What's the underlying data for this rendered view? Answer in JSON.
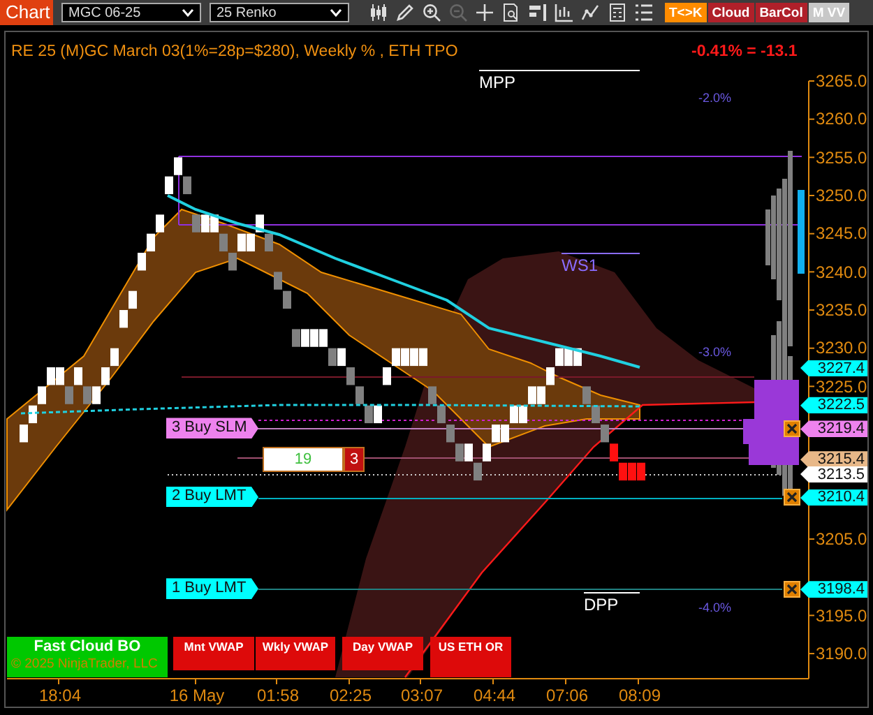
{
  "toolbar": {
    "title": "Chart",
    "instrument": "MGC 06-25",
    "bar_type": "25 Renko",
    "buttons": [
      {
        "label": "T<>K",
        "color": "#ff8c00"
      },
      {
        "label": "Cloud",
        "color": "#b0202a"
      },
      {
        "label": "BarCol",
        "color": "#b0202a"
      },
      {
        "label": "M VV",
        "color": "#c8c8c8"
      }
    ]
  },
  "chart": {
    "header": "RE 25 (M)GC March 03(1%=28p=$280), Weekly % , ETH TPO",
    "change": "-0.41% = -13.1",
    "levels": [
      {
        "label": "MPP",
        "kind": "pivot"
      },
      {
        "label": "WS1",
        "kind": "support"
      },
      {
        "label": "DPP",
        "kind": "pivot"
      }
    ],
    "percent_labels": [
      "-2.0%",
      "-3.0%",
      "-4.0%"
    ],
    "price_axis": [
      "3265.0",
      "3260.0",
      "3255.0",
      "3250.0",
      "3245.0",
      "3240.0",
      "3235.0",
      "3230.0",
      "3225.0",
      "3205.0",
      "3195.0",
      "3190.0"
    ],
    "price_markers": [
      {
        "label": "3227.4",
        "color": "#00ffff"
      },
      {
        "label": "3222.5",
        "color": "#00ffff"
      },
      {
        "label": "3219.4",
        "color": "#ee82ee"
      },
      {
        "label": "3215.4",
        "color": "#e8b888"
      },
      {
        "label": "3213.5",
        "color": "#ffffff"
      },
      {
        "label": "3210.4",
        "color": "#00ffff"
      },
      {
        "label": "3198.4",
        "color": "#00ffff"
      }
    ],
    "orders": [
      {
        "label": "3 Buy SLM",
        "color": "#ee82ee"
      },
      {
        "label": "2 Buy LMT",
        "color": "#00ffff"
      },
      {
        "label": "1 Buy LMT",
        "color": "#00ffff"
      }
    ],
    "position": {
      "quantity": "19",
      "pnl": "3"
    },
    "time_axis": [
      "18:04",
      "16 May",
      "01:58",
      "02:25",
      "03:07",
      "04:44",
      "07:06",
      "08:09"
    ],
    "copyright": "© 2025 NinjaTrader, LLC",
    "panel_buttons": [
      {
        "label": "Fast Cloud BO",
        "color": "#00c800"
      },
      {
        "label": "Mnt VWAP",
        "color": "#dd0a0a"
      },
      {
        "label": "Wkly VWAP",
        "color": "#dd0a0a"
      },
      {
        "label": "Day VWAP",
        "color": "#dd0a0a"
      },
      {
        "label": "US ETH OR",
        "color": "#dd0a0a"
      }
    ]
  }
}
